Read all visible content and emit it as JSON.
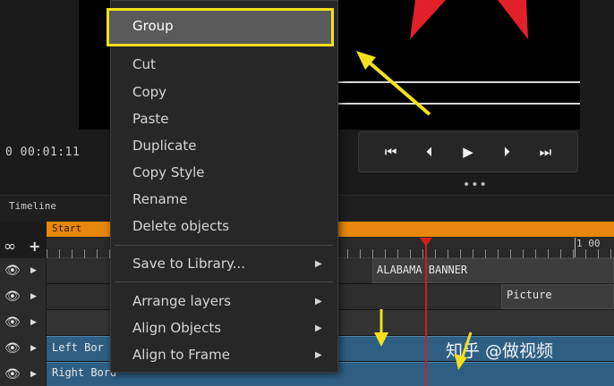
{
  "preview": {
    "timecode": "0 00:01:11",
    "controls": [
      {
        "name": "skip-to-start-icon",
        "glyph": "⏮"
      },
      {
        "name": "step-back-icon",
        "glyph": "⏴"
      },
      {
        "name": "play-icon",
        "glyph": "▶"
      },
      {
        "name": "step-forward-icon",
        "glyph": "⏵"
      },
      {
        "name": "skip-to-end-icon",
        "glyph": "⏭"
      }
    ],
    "more_dots": "•••"
  },
  "timeline": {
    "label": "Timeline",
    "start_label": "Start",
    "ruler_mark": "1 00",
    "loop_glyph": "∞",
    "add_glyph": "+",
    "eye_glyph": "👁",
    "expand_glyph": "▶",
    "tracks": [
      {
        "clip_label": "ALABAMA BANNER"
      },
      {
        "clip_label": "Picture"
      },
      {
        "clip_label": ""
      },
      {
        "clip_label": "Left Bor"
      },
      {
        "clip_label": "Right Bord"
      }
    ]
  },
  "context_menu": {
    "highlighted": "Group",
    "items": [
      {
        "label": "Cut"
      },
      {
        "label": "Copy"
      },
      {
        "label": "Paste"
      },
      {
        "label": "Duplicate"
      },
      {
        "label": "Copy Style"
      },
      {
        "label": "Rename"
      },
      {
        "label": "Delete objects"
      }
    ],
    "library_item": {
      "label": "Save to Library..."
    },
    "arrange_items": [
      {
        "label": "Arrange layers"
      },
      {
        "label": "Align Objects"
      },
      {
        "label": "Align to Frame"
      }
    ],
    "submenu_glyph": "▶"
  },
  "watermark": "知乎 @做视频",
  "colors": {
    "highlight_box": "#f2e01c",
    "annotation_arrow": "#f2e01c",
    "start_bar": "#e7870b",
    "playhead": "#d31c1c",
    "clip_blue": "#2e5f83",
    "preview_shape": "#e2202a"
  }
}
